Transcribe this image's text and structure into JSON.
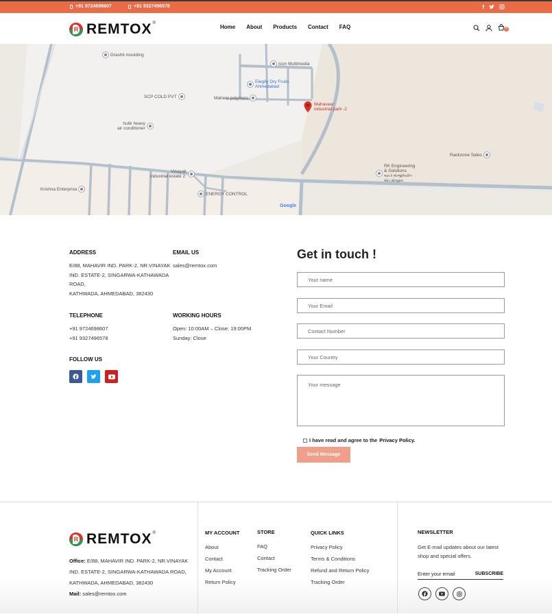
{
  "topbar": {
    "phone1": "+91 9724698607",
    "phone2": "+91 9327496578",
    "social": [
      "facebook-icon",
      "twitter-icon",
      "instagram-icon"
    ]
  },
  "brand": {
    "name": "REMTOX",
    "reg": "®",
    "mark": "R"
  },
  "nav": {
    "items": [
      "Home",
      "About",
      "Products",
      "Contact",
      "FAQ"
    ]
  },
  "header": {
    "cart_count": "0"
  },
  "map": {
    "labels": {
      "drashti": "Drashti moulding",
      "icon_multimedia": "Icon Multimedia",
      "elegity1": "Elegity Dry Fruits",
      "elegity2": "Ahmedabad",
      "scp": "SCP COLD PVT",
      "maheer": "Maheer polymers",
      "mahaveer1": "Mahaveer",
      "mahaveer2": "industrial park -2",
      "hulik1": "hulik heavy",
      "hulik2": "air conditioner",
      "rackzone": "Rackzone Sales",
      "rk1": "RK Engineering",
      "rk2": "& Solutions",
      "rk3": "આર કે એન્જીનિયરિંગ",
      "rk4": "એન્ડ સોલ્યુશન",
      "vinayak1": "Vinayak",
      "vinayak2": "industrial estate 2",
      "krishna": "Krishna Enterprise",
      "energy": "ENERGY CONTROL"
    },
    "google": "Google"
  },
  "contact": {
    "address_heading": "ADDRESS",
    "address_lines": [
      "E/88, MAHAVIR IND. PARK-2, NR.VINAYAK",
      "IND. ESTATE-2, SINGARWA-KATHAWADA",
      "ROAD,",
      "KATHWADA, AHMEDABAD, 382430"
    ],
    "email_heading": "EMAIL US",
    "email": "sales@remtox.com",
    "telephone_heading": "TELEPHONE",
    "phones": [
      "+91 9724698607",
      "+91 9327496578"
    ],
    "hours_heading": "WORKING HOURS",
    "hours": [
      "Open: 10:00AM – Close: 19:00PM",
      "Sunday: Close"
    ],
    "follow_heading": "FOLLOW US"
  },
  "form": {
    "title": "Get in touch !",
    "name_placeholder": "Your name",
    "email_placeholder": "Your Email",
    "phone_placeholder": "Contact Number",
    "country_placeholder": "Your Country",
    "message_placeholder": "Your message",
    "agree_text": "I have read and agree to the",
    "agree_link": "Privacy Policy.",
    "send_label": "Send Message"
  },
  "footer": {
    "office_label": "Office:",
    "office_text": "E/88, MAHAVIR IND. PARK-2, NR.VINAYAK IND. ESTATE-2, SINGARWA-KATHAWADA ROAD, KATHWADA, AHMEDABAD, 382430",
    "mail_label": "Mail:",
    "mail": "sales@remtox.com",
    "my_account": {
      "title": "MY ACCOUNT",
      "links": [
        "About",
        "Contact",
        "My Account",
        "Return Policy"
      ]
    },
    "store": {
      "title": "STORE",
      "links": [
        "FAQ",
        "Contact",
        "Tracking Order"
      ]
    },
    "quick_links": {
      "title": "QUICK LINKS",
      "links": [
        "Privacy Policy",
        "Terms & Conditions",
        "Refund and Return Policy",
        "Tracking Order"
      ]
    },
    "newsletter": {
      "title": "NEWSLETTER",
      "text": "Get E-mail updates about our latest shop and special offers.",
      "placeholder": "Enter your email",
      "subscribe": "SUBSCRIBE"
    }
  },
  "colors": {
    "accent": "#ea6b45",
    "facebook": "#3b5998",
    "twitter": "#1da1f2",
    "youtube": "#cd201f"
  }
}
